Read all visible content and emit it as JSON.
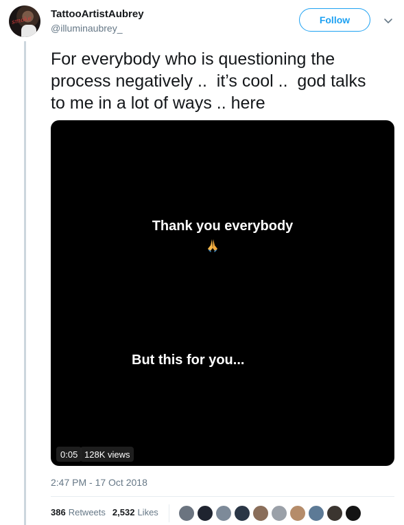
{
  "author": {
    "name": "TattooArtistAubrey",
    "handle": "@illuminaubrey_",
    "avatar_icon": "profile-photo"
  },
  "follow_button": {
    "label": "Follow",
    "color": "#1da1f2"
  },
  "menu_icon": "chevron-down-icon",
  "tweet": {
    "text": "For everybody who is questioning the\nprocess negatively ..  it’s cool ..  god talks\nto me in a lot of ways .. here"
  },
  "video": {
    "caption_line1": "Thank you everybody",
    "emoji": "folded-hands-icon",
    "caption_line2": "But this for you...",
    "duration": "0:05",
    "views": "128K views"
  },
  "timestamp": "2:47 PM - 17 Oct 2018",
  "stats": {
    "retweets_count": "386",
    "retweets_label": "Retweets",
    "likes_count": "2,532",
    "likes_label": "Likes"
  },
  "likers": [
    {
      "color": "#6b7480"
    },
    {
      "color": "#1f2430"
    },
    {
      "color": "#7d8a99"
    },
    {
      "color": "#2a3646"
    },
    {
      "color": "#8a6e5a"
    },
    {
      "color": "#9aa0a8"
    },
    {
      "color": "#b58c6a"
    },
    {
      "color": "#5d7a96"
    },
    {
      "color": "#3b3530"
    },
    {
      "color": "#141414"
    }
  ],
  "colors": {
    "text": "#14171a",
    "secondary": "#657786",
    "accent": "#1da1f2",
    "thread_line": "#ccd6dd"
  }
}
